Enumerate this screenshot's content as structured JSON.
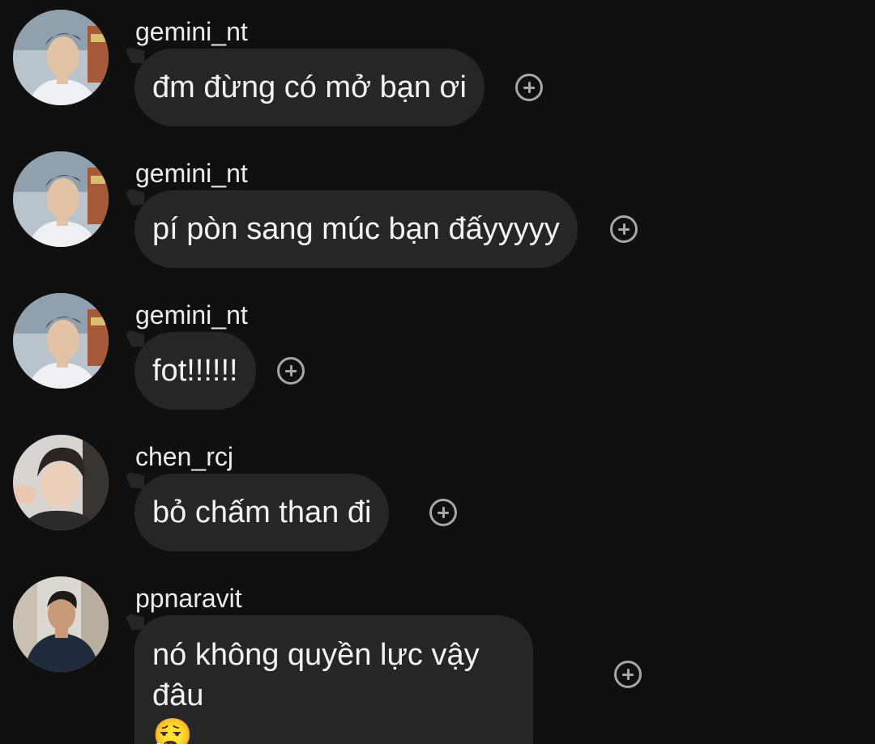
{
  "messages": [
    {
      "username": "gemini_nt",
      "text": "đm đừng có mở bạn ơi",
      "avatar": "portrait-gemini-avatar"
    },
    {
      "username": "gemini_nt",
      "text": "pí pòn sang múc bạn đấyyyyy",
      "avatar": "portrait-gemini-avatar"
    },
    {
      "username": "gemini_nt",
      "text": "fot!!!!!!",
      "avatar": "portrait-gemini-avatar"
    },
    {
      "username": "chen_rcj",
      "text": "bỏ chấm than đi",
      "avatar": "portrait-chen-avatar"
    },
    {
      "username": "ppnaravit",
      "text": "nó không quyền lực vậy đâu",
      "emoji": "😮‍💨",
      "avatar": "portrait-ppnaravit-avatar"
    }
  ],
  "icons": {
    "react": "add-reaction-icon"
  },
  "colors": {
    "background": "#101010",
    "bubble": "#262626",
    "text": "#f3f3f3",
    "icon": "#a7a7a7"
  }
}
